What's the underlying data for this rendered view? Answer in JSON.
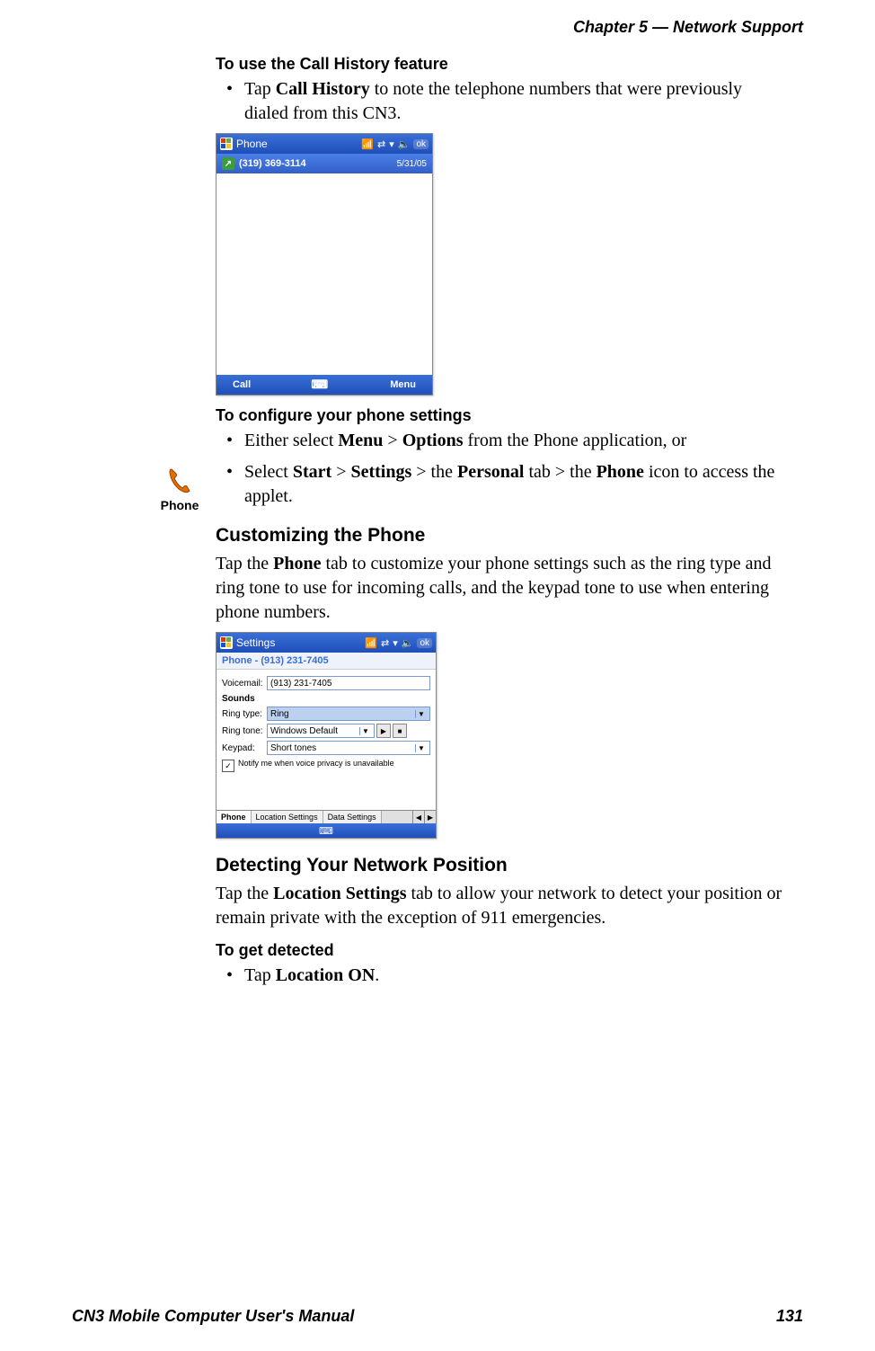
{
  "header": "Chapter 5 —  Network Support",
  "sec1": {
    "title": "To use the Call History feature",
    "bullet_pre": "Tap ",
    "bullet_bold": "Call History",
    "bullet_post": " to note the telephone numbers that were previously dialed from this CN3."
  },
  "shot1": {
    "title": "Phone",
    "ok": "ok",
    "entry_number": "(319) 369-3114",
    "entry_date": "5/31/05",
    "softkey_left": "Call",
    "softkey_right": "Menu"
  },
  "sec2": {
    "title": "To configure your phone settings",
    "b1_pre": "Either select ",
    "b1_b1": "Menu",
    "b1_sep1": " > ",
    "b1_b2": "Options",
    "b1_post": " from the Phone application, or",
    "b2_pre": "Select ",
    "b2_b1": "Start",
    "b2_s1": " > ",
    "b2_b2": "Settings",
    "b2_s2": " > the ",
    "b2_b3": "Personal",
    "b2_s3": " tab > the ",
    "b2_b4": "Phone",
    "b2_post": " icon to access the applet."
  },
  "side_icon_label": "Phone",
  "sec3": {
    "title": "Customizing the Phone",
    "p_pre": "Tap the ",
    "p_b": "Phone",
    "p_post": " tab to customize your phone settings such as the ring type and ring tone to use for incoming calls, and the keypad tone to use when entering phone numbers."
  },
  "shot2": {
    "title": "Settings",
    "ok": "ok",
    "subtitle": "Phone - (913) 231-7405",
    "voicemail_label": "Voicemail:",
    "voicemail_value": "(913) 231-7405",
    "sounds_label": "Sounds",
    "ringtype_label": "Ring type:",
    "ringtype_value": "Ring",
    "ringtone_label": "Ring tone:",
    "ringtone_value": "Windows Default",
    "keypad_label": "Keypad:",
    "keypad_value": "Short tones",
    "checkbox_label": "Notify me when voice privacy is unavailable",
    "tabs": [
      "Phone",
      "Location Settings",
      "Data Settings"
    ]
  },
  "sec4": {
    "title": "Detecting Your Network Position",
    "p_pre": "Tap the ",
    "p_b": "Location Settings",
    "p_post": " tab to allow your network to detect your position or remain private with the exception of 911 emergencies."
  },
  "sec5": {
    "title": "To get detected",
    "bullet_pre": "Tap ",
    "bullet_bold": "Location ON",
    "bullet_post": "."
  },
  "footer_left": "CN3 Mobile Computer User's Manual",
  "footer_right": "131"
}
